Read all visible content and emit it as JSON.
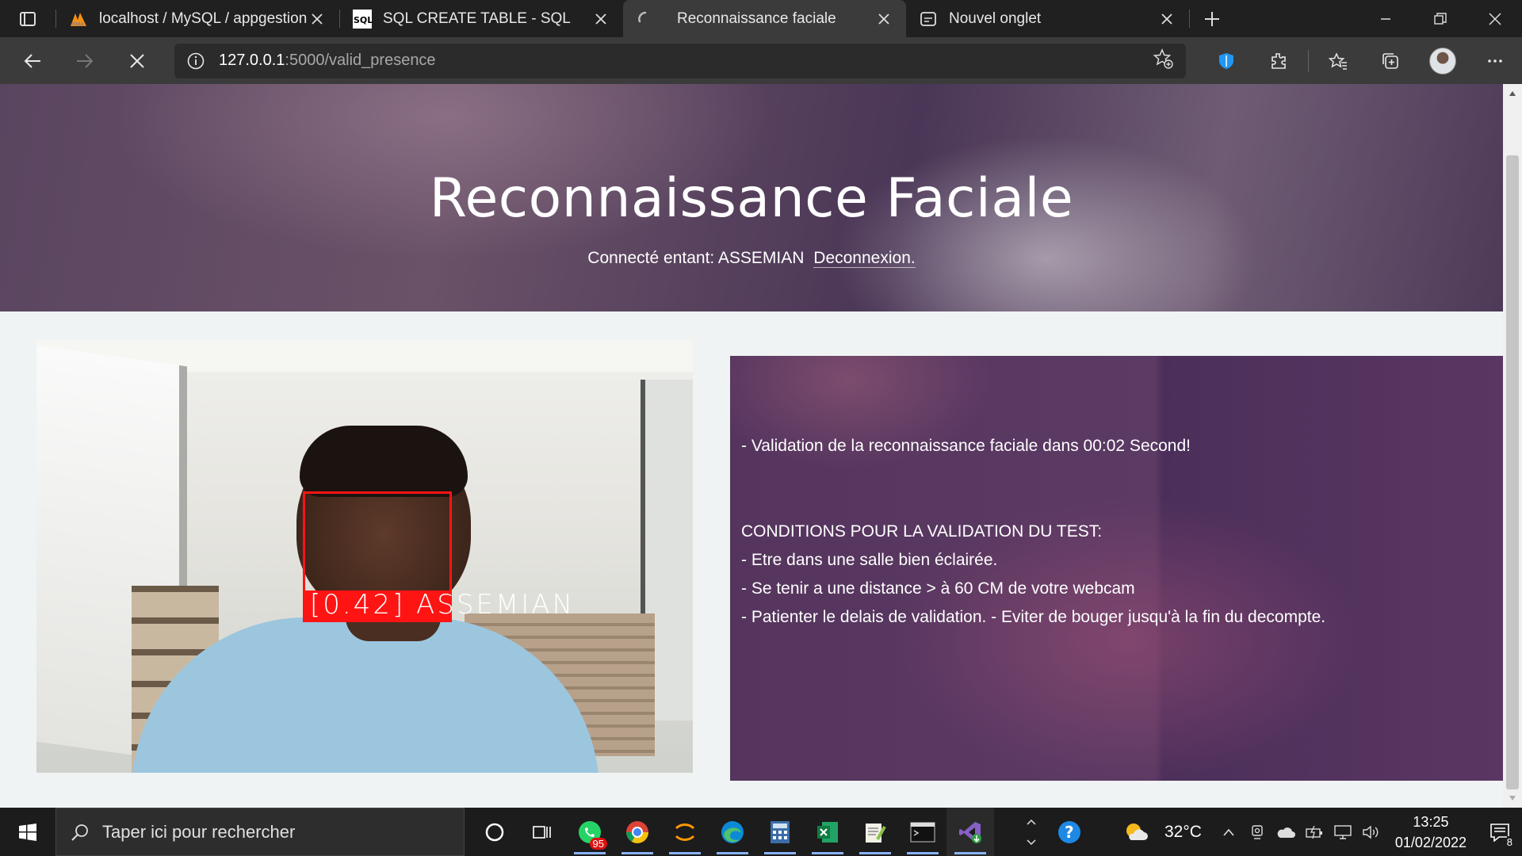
{
  "browser": {
    "tabs": [
      {
        "title": "localhost / MySQL / appgestionr",
        "icon": "phpmyadmin-icon",
        "active": false
      },
      {
        "title": "SQL CREATE TABLE - SQL",
        "icon": "sql-icon",
        "active": false
      },
      {
        "title": "Reconnaissance faciale",
        "icon": "loading-spinner-icon",
        "active": true
      },
      {
        "title": "Nouvel onglet",
        "icon": "new-tab-page-icon",
        "active": false
      }
    ],
    "url_host": "127.0.0.1",
    "url_path": ":5000/valid_presence"
  },
  "page": {
    "title": "Reconnaissance Faciale",
    "connected_label": "Connecté entant: ASSEMIAN",
    "logout_link": "Deconnexion.",
    "webcam": {
      "detection_label": "[0.42] ASSEMIAN",
      "confidence": 0.42,
      "person": "ASSEMIAN"
    },
    "info": {
      "status": "- Validation de la reconnaissance faciale dans 00:02 Second!",
      "conditions_title": "CONDITIONS POUR LA VALIDATION DU TEST:",
      "conditions": [
        "- Etre dans une salle bien éclairée.",
        "- Se tenir a une distance > à 60 CM de votre webcam",
        "- Patienter le delais de validation. - Eviter de bouger jusqu'à la fin du decompte."
      ]
    }
  },
  "taskbar": {
    "search_placeholder": "Taper ici pour rechercher",
    "whatsapp_badge": "95",
    "weather": "32°C",
    "time": "13:25",
    "date": "01/02/2022",
    "notifications": "8"
  },
  "colors": {
    "detection_red": "#ff1414",
    "hero_purple": "#5a4560",
    "panel_purple": "#55355e",
    "page_bg": "#f0f3f4"
  }
}
